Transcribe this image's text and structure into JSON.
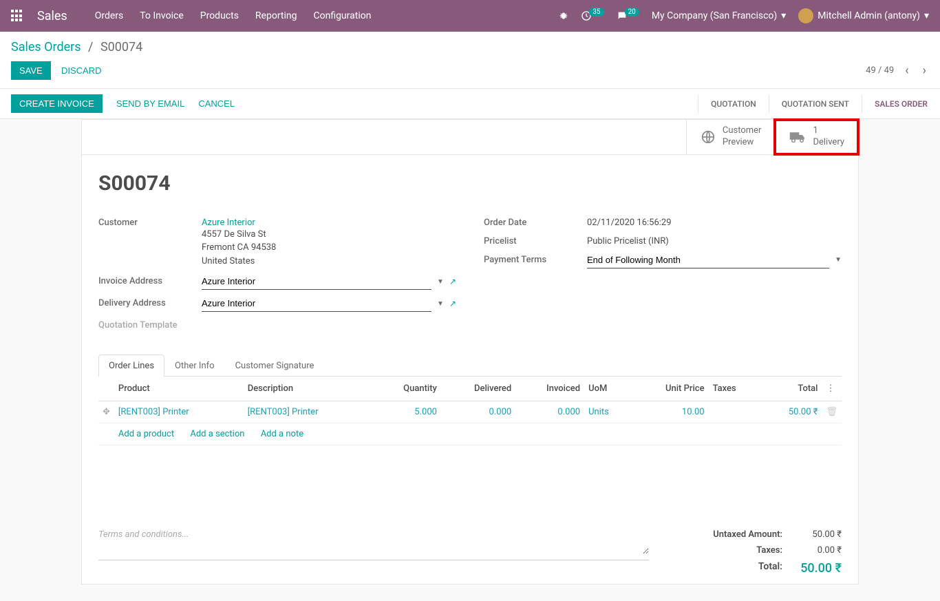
{
  "topnav": {
    "brand": "Sales",
    "menu": [
      "Orders",
      "To Invoice",
      "Products",
      "Reporting",
      "Configuration"
    ],
    "clock_badge": "35",
    "chat_badge": "20",
    "company": "My Company (San Francisco)",
    "user": "Mitchell Admin (antony)"
  },
  "breadcrumb": {
    "parent": "Sales Orders",
    "current": "S00074"
  },
  "actions": {
    "save": "SAVE",
    "discard": "DISCARD"
  },
  "pager": {
    "text": "49 / 49"
  },
  "statusbar": {
    "buttons": {
      "create_invoice": "CREATE INVOICE",
      "send_email": "SEND BY EMAIL",
      "cancel": "CANCEL"
    },
    "steps": [
      "QUOTATION",
      "QUOTATION SENT",
      "SALES ORDER"
    ],
    "active_index": 2
  },
  "stat_buttons": {
    "preview": {
      "line1": "Customer",
      "line2": "Preview"
    },
    "delivery": {
      "count": "1",
      "label": "Delivery"
    }
  },
  "form": {
    "title": "S00074",
    "left": {
      "customer_label": "Customer",
      "customer_name": "Azure Interior",
      "customer_addr1": "4557 De Silva St",
      "customer_addr2": "Fremont CA 94538",
      "customer_addr3": "United States",
      "invoice_addr_label": "Invoice Address",
      "invoice_addr_val": "Azure Interior",
      "delivery_addr_label": "Delivery Address",
      "delivery_addr_val": "Azure Interior",
      "quotation_tpl_label": "Quotation Template"
    },
    "right": {
      "order_date_label": "Order Date",
      "order_date_val": "02/11/2020 16:56:29",
      "pricelist_label": "Pricelist",
      "pricelist_val": "Public Pricelist (INR)",
      "payment_terms_label": "Payment Terms",
      "payment_terms_val": "End of Following Month"
    }
  },
  "tabs": [
    "Order Lines",
    "Other Info",
    "Customer Signature"
  ],
  "table": {
    "headers": {
      "product": "Product",
      "description": "Description",
      "quantity": "Quantity",
      "delivered": "Delivered",
      "invoiced": "Invoiced",
      "uom": "UoM",
      "unit_price": "Unit Price",
      "taxes": "Taxes",
      "total": "Total"
    },
    "row": {
      "product": "[RENT003] Printer",
      "description": "[RENT003] Printer",
      "quantity": "5.000",
      "delivered": "0.000",
      "invoiced": "0.000",
      "uom": "Units",
      "unit_price": "10.00",
      "taxes": "",
      "total": "50.00 ₹"
    },
    "add_product": "Add a product",
    "add_section": "Add a section",
    "add_note": "Add a note"
  },
  "terms_placeholder": "Terms and conditions...",
  "totals": {
    "untaxed_label": "Untaxed Amount:",
    "untaxed_val": "50.00 ₹",
    "taxes_label": "Taxes:",
    "taxes_val": "0.00 ₹",
    "total_label": "Total:",
    "total_val": "50.00 ₹"
  }
}
